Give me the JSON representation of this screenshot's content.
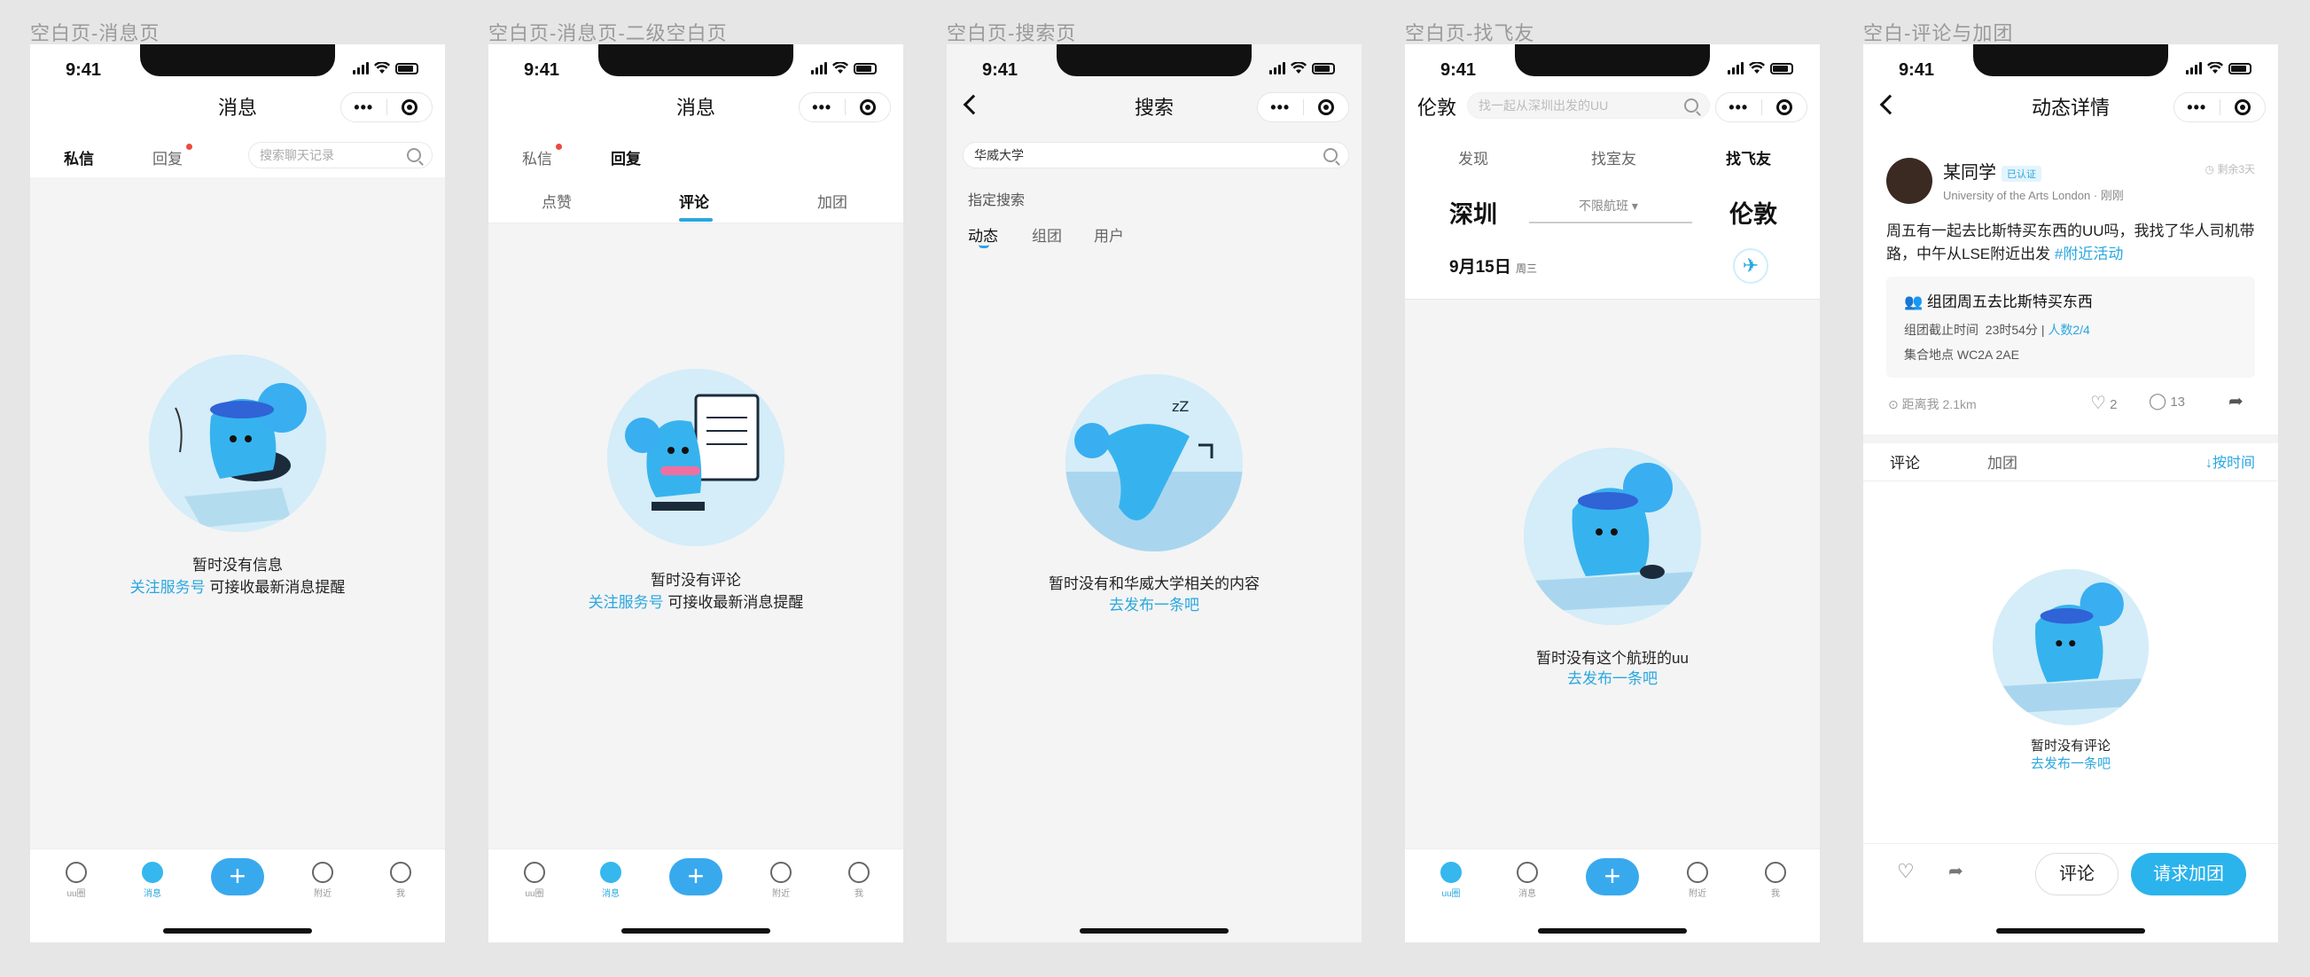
{
  "captions": [
    "空白页-消息页",
    "空白页-消息页-二级空白页",
    "空白页-搜索页",
    "空白页-找飞友",
    "空白-评论与加团"
  ],
  "status_time": "9:41",
  "capsule": {
    "dots": "•••"
  },
  "tabbar": {
    "items": [
      "uu圈",
      "消息",
      "附近",
      "我"
    ],
    "plus": "+"
  },
  "screen1": {
    "title": "消息",
    "tabs": [
      "私信",
      "回复"
    ],
    "search_placeholder": "搜索聊天记录",
    "empty_title": "暂时没有信息",
    "empty_link": "关注服务号",
    "empty_suffix": " 可接收最新消息提醒"
  },
  "screen2": {
    "title": "消息",
    "tabs": [
      "私信",
      "回复"
    ],
    "subtabs": [
      "点赞",
      "评论",
      "加团"
    ],
    "empty_title": "暂时没有评论",
    "empty_link": "关注服务号",
    "empty_suffix": " 可接收最新消息提醒"
  },
  "screen3": {
    "title": "搜索",
    "search_value": "华威大学",
    "section_label": "指定搜索",
    "filters": [
      "动态",
      "组团",
      "用户"
    ],
    "empty_title": "暂时没有和华威大学相关的内容",
    "empty_link": "去发布一条吧"
  },
  "screen4": {
    "city_nav": "伦敦",
    "search_placeholder": "找一起从深圳出发的UU",
    "tabs": [
      "发现",
      "找室友",
      "找飞友"
    ],
    "from_city": "深圳",
    "to_city": "伦敦",
    "flight_filter": "不限航班",
    "date": "9月15日",
    "weekday": "周三",
    "empty_title": "暂时没有这个航班的uu",
    "empty_link": "去发布一条吧"
  },
  "screen5": {
    "title": "动态详情",
    "user_name": "某同学",
    "verified": "已认证",
    "user_meta": "University of the Arts London · 刚刚",
    "remaining": "剩余3天",
    "post_text": "周五有一起去比斯特买东西的UU吗，我找了华人司机带路，中午从LSE附近出发",
    "post_tag": "#附近活动",
    "group_title": "组团周五去比斯特买东西",
    "deadline_label": "组团截止时间",
    "deadline_value": "23时54分",
    "people": "人数2/4",
    "meeting": "集合地点 WC2A 2AE",
    "distance": "距离我 2.1km",
    "likes": "2",
    "comments": "13",
    "tabs": [
      "评论",
      "加团"
    ],
    "sort": "按时间",
    "empty_title": "暂时没有评论",
    "empty_link": "去发布一条吧",
    "comment_btn": "评论",
    "join_btn": "请求加团"
  }
}
